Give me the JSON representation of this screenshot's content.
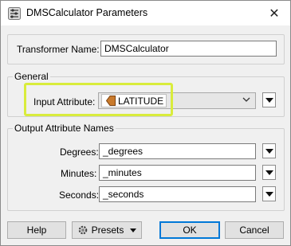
{
  "window": {
    "title": "DMSCalculator Parameters",
    "close_label": "✕"
  },
  "transformer": {
    "label": "Transformer Name:",
    "value": "DMSCalculator"
  },
  "general": {
    "legend": "General",
    "input_attribute_label": "Input Attribute:",
    "input_attribute_value": "LATITUDE",
    "highlight_color": "#d9ec3c"
  },
  "output": {
    "legend": "Output Attribute Names",
    "degrees_label": "Degrees:",
    "degrees_value": "_degrees",
    "minutes_label": "Minutes:",
    "minutes_value": "_minutes",
    "seconds_label": "Seconds:",
    "seconds_value": "_seconds"
  },
  "buttons": {
    "help": "Help",
    "presets": "Presets",
    "ok": "OK",
    "cancel": "Cancel"
  },
  "icons": {
    "app": "fme-transformer-icon",
    "attribute": "attribute-tag-icon",
    "presets": "gear-icon",
    "dropdown": "chevron-down-icon",
    "menu": "triangle-down-icon"
  },
  "colors": {
    "accent": "#0078d7",
    "attribute_icon": "#b5651d"
  }
}
